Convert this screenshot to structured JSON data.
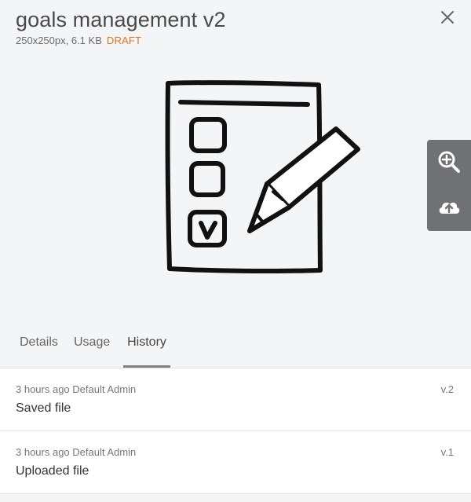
{
  "file": {
    "title": "goals management v2",
    "dimensions": "250x250px, 6.1 KB",
    "status": "DRAFT"
  },
  "icons": {
    "close": "close-icon",
    "zoom": "zoom-in-icon",
    "upload": "cloud-upload-icon",
    "preview": "checklist-pencil-icon"
  },
  "colors": {
    "status_draft": "#e8731c",
    "toolbar_bg": "#6f7174",
    "active_tab_underline": "#7f8082"
  },
  "tabs": [
    {
      "label": "Details"
    },
    {
      "label": "Usage"
    },
    {
      "label": "History"
    }
  ],
  "active_tab": "History",
  "history": [
    {
      "when": "3 hours ago Default Admin",
      "action": "Saved file",
      "version": "v.2"
    },
    {
      "when": "3 hours ago Default Admin",
      "action": "Uploaded file",
      "version": "v.1"
    }
  ]
}
